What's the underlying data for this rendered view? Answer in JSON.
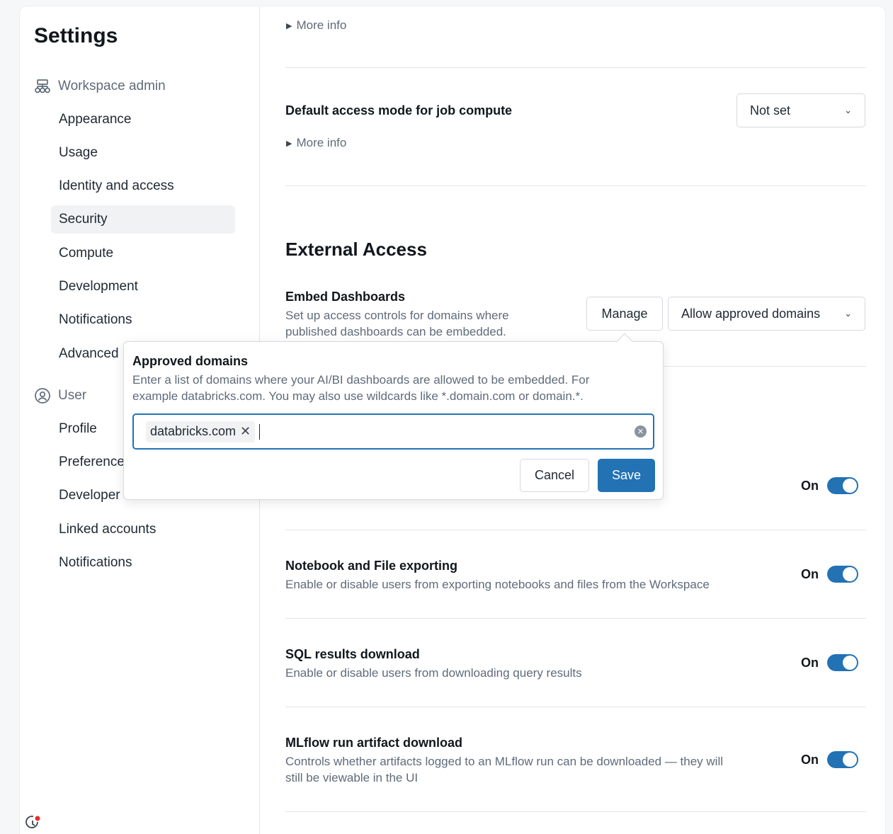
{
  "sidebar": {
    "title": "Settings",
    "workspace_admin": {
      "label": "Workspace admin",
      "items": [
        "Appearance",
        "Usage",
        "Identity and access",
        "Security",
        "Compute",
        "Development",
        "Notifications",
        "Advanced"
      ]
    },
    "user": {
      "label": "User",
      "items": [
        "Profile",
        "Preferences",
        "Developer",
        "Linked accounts",
        "Notifications"
      ]
    },
    "active_item": "Security"
  },
  "main": {
    "more_info": "More info",
    "job_compute": {
      "title": "Default access mode for job compute",
      "select_value": "Not set",
      "more_info": "More info"
    },
    "section_title": "External Access",
    "embed": {
      "title": "Embed Dashboards",
      "description_line1": "Set up access controls for domains where",
      "description_line2": "published dashboards can be embedded.",
      "manage_label": "Manage",
      "select_value": "Allow approved domains"
    },
    "toggles": [
      {
        "title": "",
        "description": "",
        "state_label": "On"
      },
      {
        "title": "Notebook and File exporting",
        "description": "Enable or disable users from exporting notebooks and files from the Workspace",
        "state_label": "On"
      },
      {
        "title": "SQL results download",
        "description": "Enable or disable users from downloading query results",
        "state_label": "On"
      },
      {
        "title": "MLflow run artifact download",
        "description_line1": "Controls whether artifacts logged to an MLflow run can be downloaded — they will",
        "description_line2": "still be viewable in the UI",
        "state_label": "On"
      }
    ]
  },
  "popover": {
    "title": "Approved domains",
    "description_line1": "Enter a list of domains where your AI/BI dashboards are allowed to be embedded. For",
    "description_line2": "example databricks.com. You may also use wildcards like *.domain.com or domain.*.",
    "tags": [
      "databricks.com"
    ],
    "tag_remove_glyph": "✕",
    "clear_glyph": "✕",
    "cancel_label": "Cancel",
    "save_label": "Save"
  },
  "colors": {
    "accent": "#2272b4",
    "active_nav_bg": "#f1f2f4",
    "notification_dot": "#e5312b"
  },
  "icons": {
    "workspace_admin": "workspace-admin-icon",
    "user": "user-circle-icon",
    "bottom": "clock-notification-icon"
  }
}
